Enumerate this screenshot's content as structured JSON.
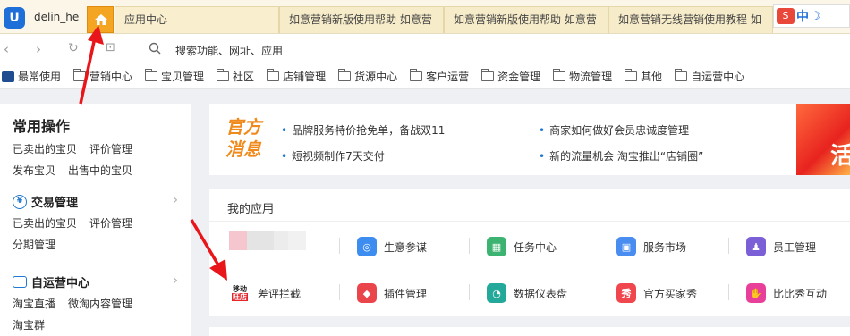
{
  "browser": {
    "user": "delin_he",
    "tabs": [
      {
        "label": "应用中心"
      },
      {
        "label": "如意营销新版使用帮助 如意营"
      },
      {
        "label": "如意营销新版使用帮助 如意营"
      },
      {
        "label": "如意营销无线营销使用教程 如"
      }
    ],
    "ext_zh": "中",
    "ext_moon": "☽",
    "search_placeholder": "搜索功能、网址、应用"
  },
  "bookmarks": [
    {
      "label": "最常使用"
    },
    {
      "label": "营销中心"
    },
    {
      "label": "宝贝管理"
    },
    {
      "label": "社区"
    },
    {
      "label": "店铺管理"
    },
    {
      "label": "货源中心"
    },
    {
      "label": "客户运营"
    },
    {
      "label": "资金管理"
    },
    {
      "label": "物流管理"
    },
    {
      "label": "其他"
    },
    {
      "label": "自运营中心"
    }
  ],
  "sidebar": {
    "common": {
      "title": "常用操作",
      "row1": [
        "已卖出的宝贝",
        "评价管理"
      ],
      "row2": [
        "发布宝贝",
        "出售中的宝贝"
      ]
    },
    "trade": {
      "title": "交易管理",
      "row1": [
        "已卖出的宝贝",
        "评价管理"
      ],
      "row2": [
        "分期管理"
      ]
    },
    "self": {
      "title": "自运营中心",
      "row1": [
        "淘宝直播",
        "微淘内容管理"
      ],
      "row2": [
        "淘宝群"
      ]
    }
  },
  "promo": {
    "label_top": "官方",
    "label_bottom": "消息",
    "items": [
      "品牌服务特价抢免单，备战双11",
      "商家如何做好会员忠诚度管理",
      "短视频制作7天交付",
      "新的流量机会 淘宝推出“店铺圈”"
    ],
    "image_char": "活"
  },
  "apps": {
    "title": "我的应用",
    "row1": [
      {
        "label": "生意参谋",
        "icon": "compass-icon",
        "color": "#3d8cf0"
      },
      {
        "label": "任务中心",
        "icon": "calendar-icon",
        "color": "#3cb371"
      },
      {
        "label": "服务市场",
        "icon": "bag-icon",
        "color": "#4a8df0"
      },
      {
        "label": "员工管理",
        "icon": "person-icon",
        "color": "#7b5fd6"
      }
    ],
    "row2": [
      {
        "label": "差评拦截",
        "icon": "logo-icon",
        "color": "#e8232a"
      },
      {
        "label": "插件管理",
        "icon": "cube-icon",
        "color": "#e9454b"
      },
      {
        "label": "数据仪表盘",
        "icon": "gauge-icon",
        "color": "#23a89a"
      },
      {
        "label": "官方买家秀",
        "icon": "show-icon",
        "color": "#f0474f"
      },
      {
        "label": "比比秀互动",
        "icon": "hand-icon",
        "color": "#e8409a"
      }
    ],
    "logo_text_top": "移动",
    "logo_text_bottom": "旺店"
  }
}
